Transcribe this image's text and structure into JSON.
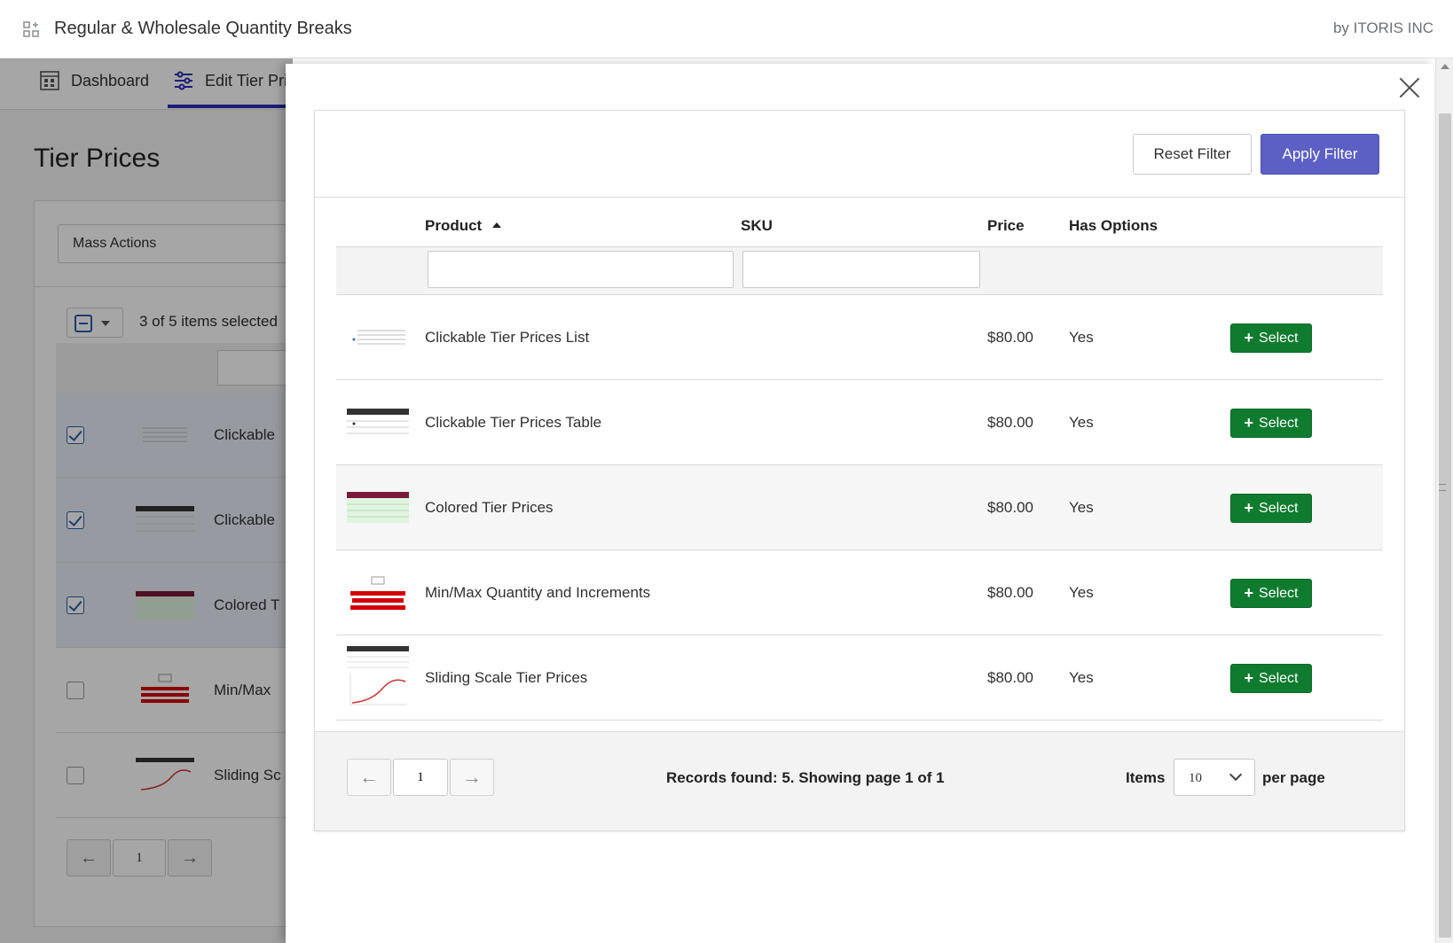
{
  "app": {
    "title": "Regular & Wholesale Quantity Breaks",
    "vendor": "by ITORIS INC"
  },
  "background": {
    "nav": [
      {
        "label": "Dashboard",
        "icon": "dashboard-icon"
      },
      {
        "label": "Edit Tier Pri",
        "icon": "sliders-icon"
      }
    ],
    "page_title": "Tier Prices",
    "mass_actions": "Mass Actions",
    "selection_text": "3 of 5 items selected",
    "rows": [
      {
        "label": "Clickable",
        "checked": true
      },
      {
        "label": "Clickable",
        "checked": true
      },
      {
        "label": "Colored T",
        "checked": true
      },
      {
        "label": "Min/Max",
        "checked": false
      },
      {
        "label": "Sliding Sc",
        "checked": false
      }
    ],
    "page_number": "1"
  },
  "modal": {
    "reset_filter": "Reset Filter",
    "apply_filter": "Apply Filter",
    "columns": {
      "product": "Product",
      "sku": "SKU",
      "price": "Price",
      "has_options": "Has Options"
    },
    "filters": {
      "product_value": "",
      "sku_value": ""
    },
    "rows": [
      {
        "product": "Clickable Tier Prices List",
        "sku": "",
        "price": "$80.00",
        "has_options": "Yes",
        "action": "Select"
      },
      {
        "product": "Clickable Tier Prices Table",
        "sku": "",
        "price": "$80.00",
        "has_options": "Yes",
        "action": "Select"
      },
      {
        "product": "Colored Tier Prices",
        "sku": "",
        "price": "$80.00",
        "has_options": "Yes",
        "action": "Select"
      },
      {
        "product": "Min/Max Quantity and Increments",
        "sku": "",
        "price": "$80.00",
        "has_options": "Yes",
        "action": "Select"
      },
      {
        "product": "Sliding Scale Tier Prices",
        "sku": "",
        "price": "$80.00",
        "has_options": "Yes",
        "action": "Select"
      }
    ],
    "footer": {
      "page_number": "1",
      "records_text": "Records found: 5. Showing page 1 of 1",
      "items_label": "Items",
      "items_value": "10",
      "per_page_label": "per page"
    }
  },
  "colors": {
    "apply": "#5c5fc4",
    "select": "#0f7b2e",
    "nav_active": "#2b2bb8"
  }
}
